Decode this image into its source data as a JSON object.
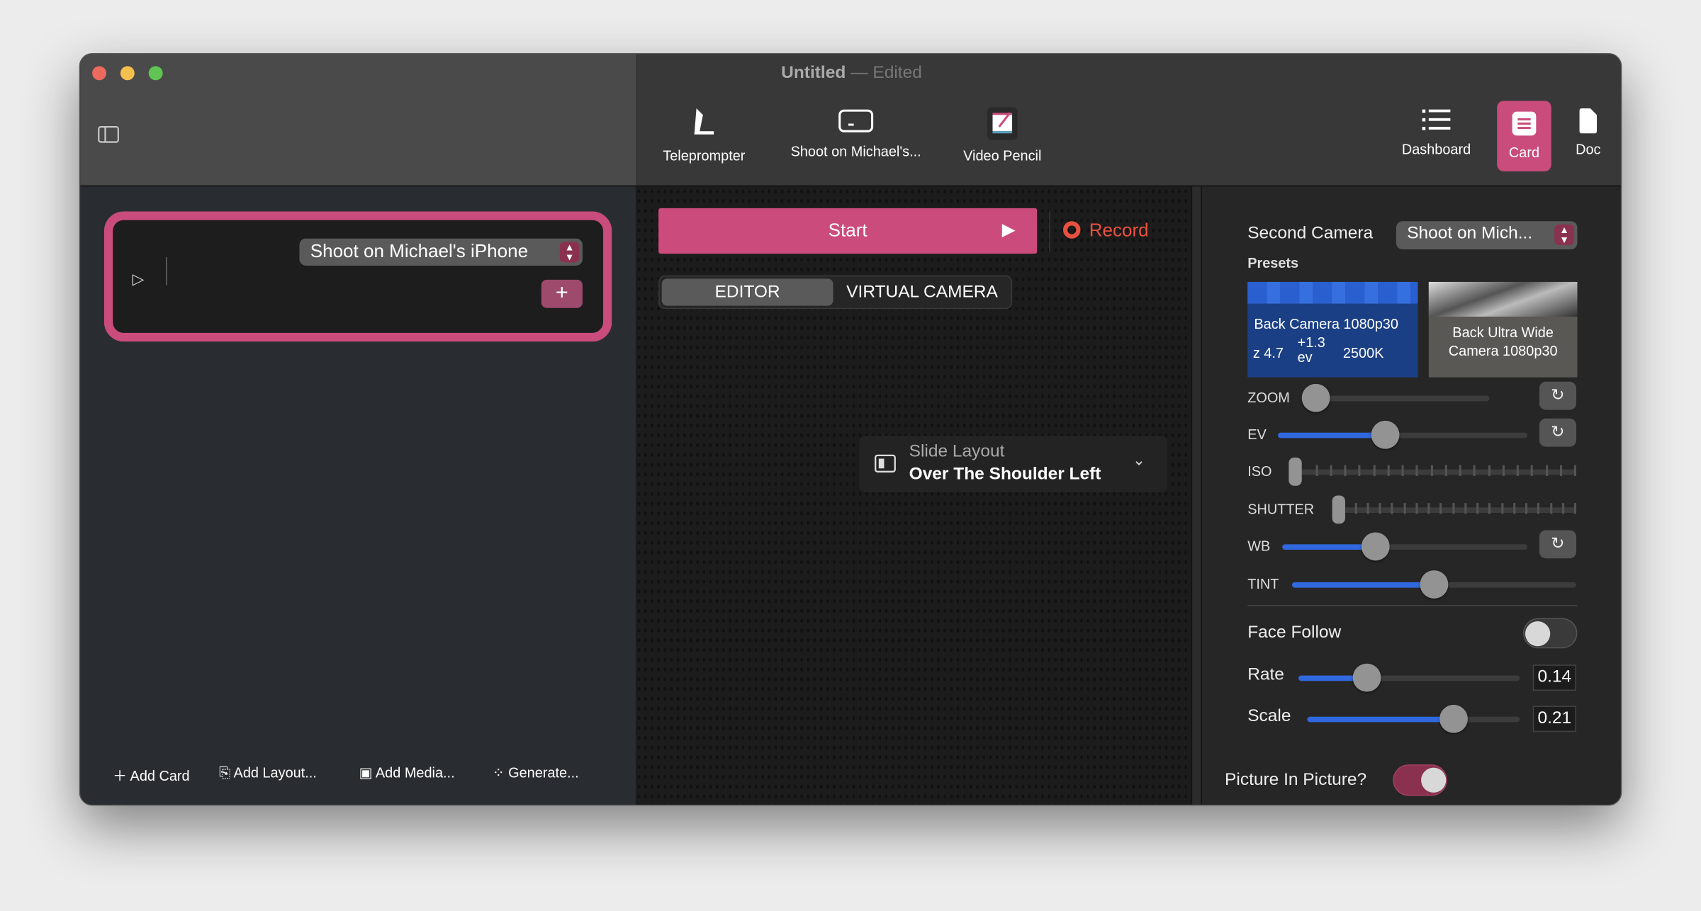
{
  "window": {
    "title": "Untitled",
    "title_sep": "—",
    "title_status": "Edited"
  },
  "toolbar": {
    "center": [
      {
        "label": "Teleprompter",
        "icon": "teleprompter-icon"
      },
      {
        "label": "Shoot on Michael's...",
        "icon": "phone-landscape-icon"
      },
      {
        "label": "Video Pencil",
        "icon": "video-pencil-icon"
      }
    ],
    "right": [
      {
        "label": "Dashboard",
        "icon": "list-icon"
      },
      {
        "label": "Card",
        "icon": "card-icon",
        "selected": true
      },
      {
        "label": "Doc",
        "icon": "doc-icon"
      }
    ]
  },
  "card": {
    "camera_select": "Shoot on Michael's iPhone",
    "add": "+"
  },
  "bottom_bar": [
    {
      "label": "Add Card",
      "icon": "plus-icon"
    },
    {
      "label": "Add Layout...",
      "icon": "add-layout-icon"
    },
    {
      "label": "Add Media...",
      "icon": "add-media-icon"
    },
    {
      "label": "Generate...",
      "icon": "magic-wand-icon"
    }
  ],
  "center": {
    "start": "Start",
    "record": "Record",
    "tabs": [
      {
        "label": "EDITOR",
        "selected": true
      },
      {
        "label": "VIRTUAL CAMERA"
      }
    ],
    "slide_layout": {
      "label": "Slide Layout",
      "value": "Over The Shoulder Left"
    }
  },
  "inspector": {
    "second_camera_label": "Second Camera",
    "second_camera_value": "Shoot on Mich...",
    "presets_label": "Presets",
    "presets": [
      {
        "name": "Back Camera 1080p30",
        "zoom": "z 4.7",
        "ev": "+1.3",
        "ev_unit": "ev",
        "wb": "2500K",
        "selected": true
      },
      {
        "name_line1": "Back Ultra Wide",
        "name_line2": "Camera 1080p30"
      }
    ],
    "sliders": [
      {
        "label": "ZOOM",
        "value": 0.05,
        "reset": true
      },
      {
        "label": "EV",
        "value": 0.43,
        "reset": true
      },
      {
        "label": "ISO",
        "value": 0,
        "ticked": true
      },
      {
        "label": "SHUTTER",
        "value": 0,
        "ticked": true
      },
      {
        "label": "WB",
        "value": 0.38,
        "reset": true
      },
      {
        "label": "TINT",
        "value": 0.5
      }
    ],
    "face_follow": {
      "label": "Face Follow",
      "on": false
    },
    "rate": {
      "label": "Rate",
      "value": "0.14",
      "fraction": 0.31
    },
    "scale": {
      "label": "Scale",
      "value": "0.21",
      "fraction": 0.69
    },
    "pip": {
      "label": "Picture In Picture?",
      "on": true
    }
  },
  "colors": {
    "accent": "#c94c7c",
    "slider": "#3068e0",
    "record": "#e8513f"
  }
}
